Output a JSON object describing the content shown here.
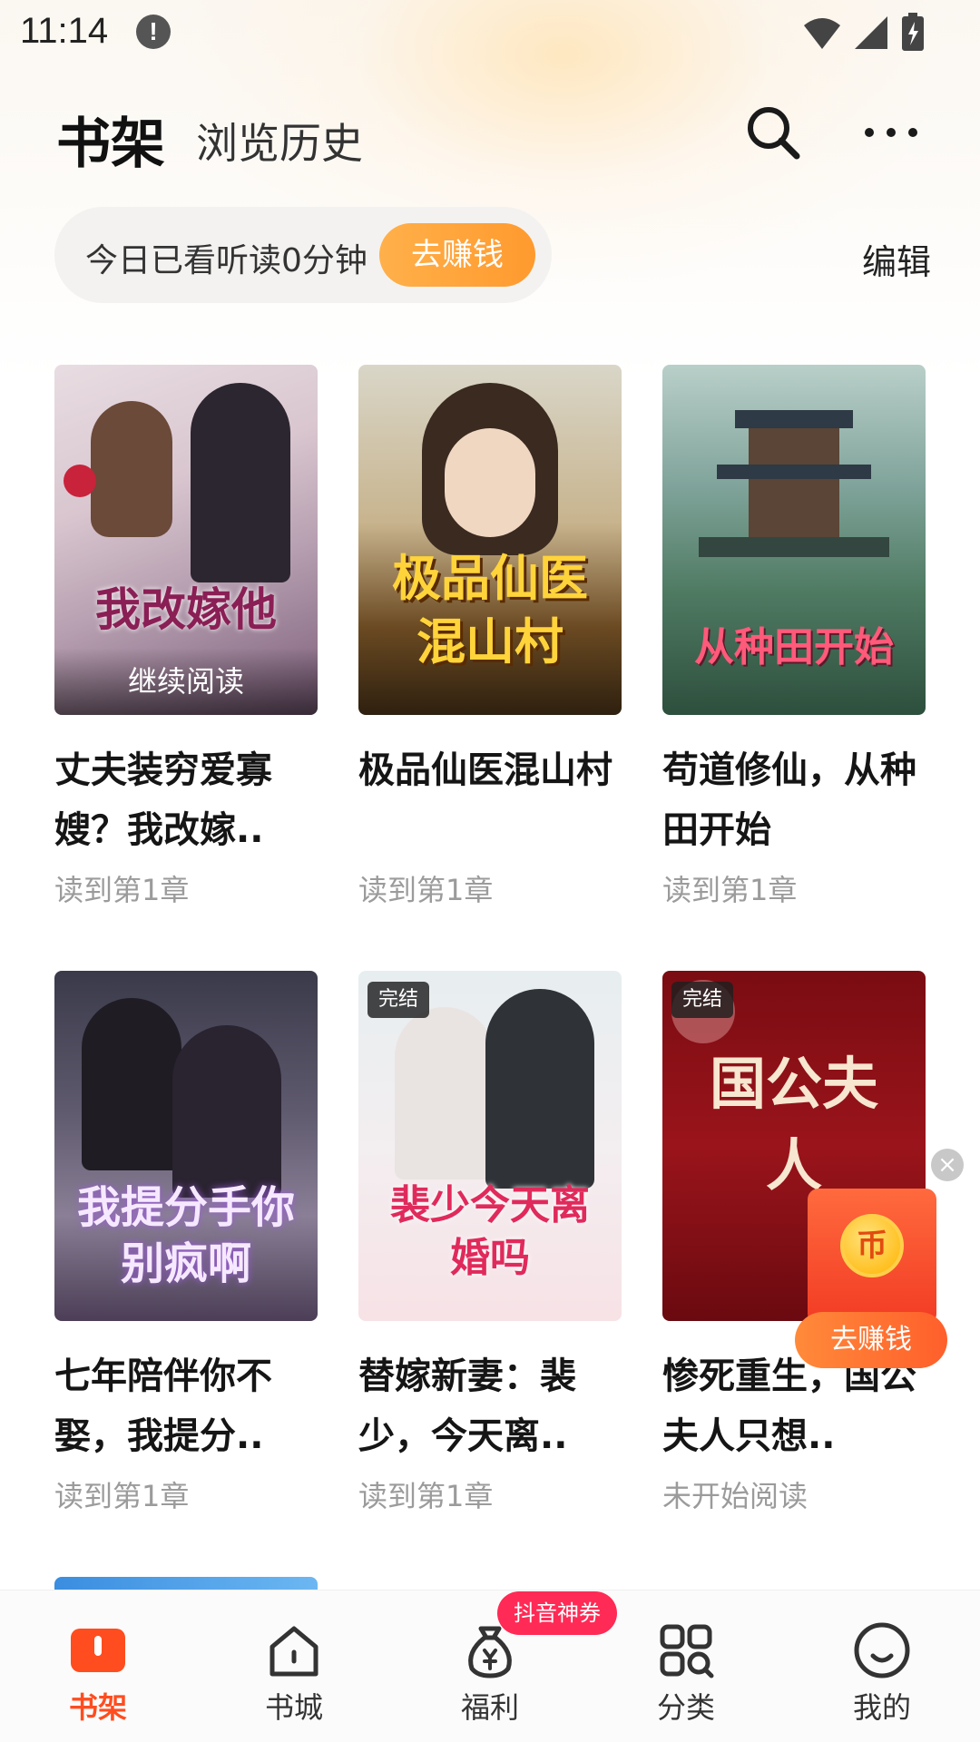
{
  "status_bar": {
    "time": "11:14",
    "alert_glyph": "!"
  },
  "header": {
    "tab_active": "书架",
    "tab_inactive": "浏览历史"
  },
  "reading_bar": {
    "text": "今日已看听读0分钟",
    "earn_label": "去赚钱",
    "edit_label": "编辑"
  },
  "books": [
    {
      "title": "丈夫装穷爱寡嫂？我改嫁..",
      "progress": "读到第1章",
      "cover_text": "我改嫁他",
      "cover_overlay": "继续阅读",
      "tag": ""
    },
    {
      "title": "极品仙医混山村",
      "progress": "读到第1章",
      "cover_text": "极品仙医混山村",
      "cover_overlay": "",
      "tag": ""
    },
    {
      "title": "苟道修仙，从种田开始",
      "progress": "读到第1章",
      "cover_text": "从种田开始",
      "cover_overlay": "",
      "tag": ""
    },
    {
      "title": "七年陪伴你不娶，我提分..",
      "progress": "读到第1章",
      "cover_text": "我提分手你别疯啊",
      "cover_overlay": "",
      "tag": ""
    },
    {
      "title": "替嫁新妻：裴少，今天离..",
      "progress": "读到第1章",
      "cover_text": "裴少今天离婚吗",
      "cover_overlay": "",
      "tag": "完结"
    },
    {
      "title": "惨死重生，国公夫人只想..",
      "progress": "未开始阅读",
      "cover_text": "国公夫人",
      "cover_overlay": "",
      "tag": "完结"
    }
  ],
  "float_widget": {
    "label": "去赚钱",
    "coin_glyph": "币",
    "close_glyph": "×"
  },
  "bottom_nav": {
    "items": [
      {
        "label": "书架",
        "icon": "bookshelf-icon",
        "active": true
      },
      {
        "label": "书城",
        "icon": "bookstore-home-icon",
        "active": false
      },
      {
        "label": "福利",
        "icon": "welfare-bag-icon",
        "active": false
      },
      {
        "label": "分类",
        "icon": "category-grid-icon",
        "active": false
      },
      {
        "label": "我的",
        "icon": "profile-smile-icon",
        "active": false
      }
    ],
    "badge": "抖音神券"
  },
  "colors": {
    "accent": "#ff4d1f",
    "earn_orange": "#ffa43c",
    "badge_pink": "#ff2a55"
  }
}
